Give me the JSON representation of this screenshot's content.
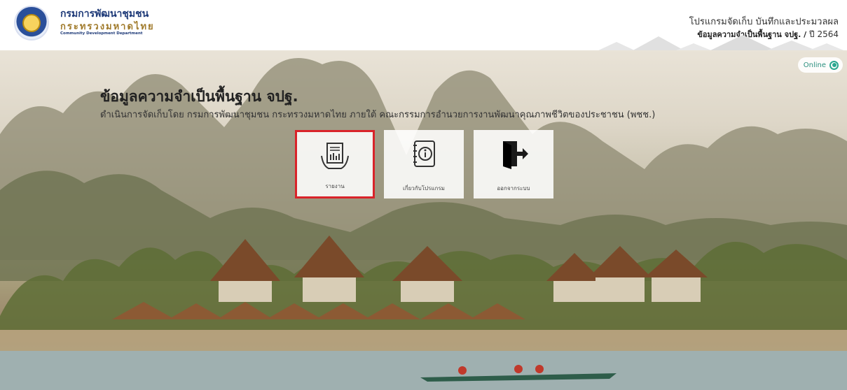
{
  "header": {
    "org_name_th": "กรมการพัฒนาชุมชน",
    "ministry_th": "กระทรวงมหาดไทย",
    "org_name_en": "Community Development Department",
    "program_title": "โปรแกรมจัดเก็บ บันทึกและประมวลผล",
    "program_subtitle": "ข้อมูลความจำเป็นพื้นฐาน จปฐ. /",
    "year": "ปี 2564"
  },
  "status": {
    "label": "Online"
  },
  "hero": {
    "title": "ข้อมูลความจำเป็นพื้นฐาน จปฐ.",
    "description": "ดำเนินการจัดเก็บโดย กรมการพัฒนาชุมชน กระทรวงมหาดไทย ภายใต้ คณะกรรมการอำนวยการงานพัฒนาคุณภาพชีวิตของประชาชน (พชช.)"
  },
  "menu": [
    {
      "label": "รายงาน",
      "icon": "report-icon",
      "selected": true
    },
    {
      "label": "เกี่ยวกับโปรแกรม",
      "icon": "info-book-icon",
      "selected": false
    },
    {
      "label": "ออกจากระบบ",
      "icon": "logout-icon",
      "selected": false
    }
  ],
  "colors": {
    "accent": "#2aa790",
    "selected_border": "#d9232a",
    "brand": "#1e3a78"
  }
}
